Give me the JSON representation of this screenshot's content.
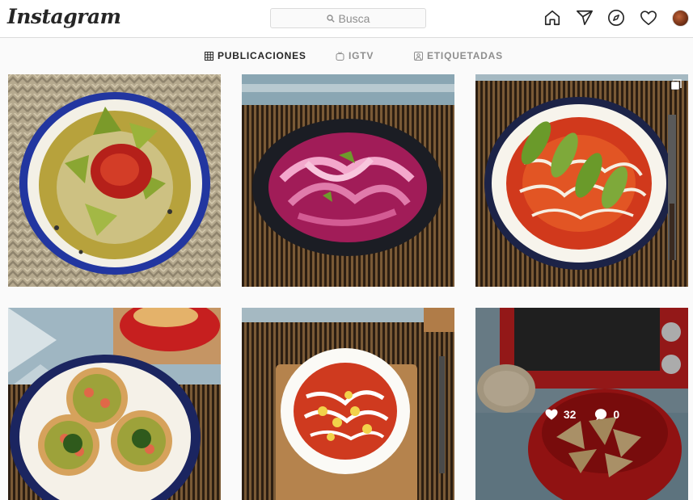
{
  "app": {
    "logo_text": "Instagram"
  },
  "search": {
    "placeholder": "Busca"
  },
  "nav": [
    {
      "name": "home-icon",
      "label": "Inicio"
    },
    {
      "name": "direct-icon",
      "label": "Direct"
    },
    {
      "name": "explore-icon",
      "label": "Explorar"
    },
    {
      "name": "heart-icon",
      "label": "Actividad"
    },
    {
      "name": "avatar",
      "label": "Perfil"
    }
  ],
  "tabs": [
    {
      "label": "PUBLICACIONES",
      "active": true,
      "icon": "grid-icon"
    },
    {
      "label": "IGTV",
      "active": false,
      "icon": "igtv-icon"
    },
    {
      "label": "ETIQUETADAS",
      "active": false,
      "icon": "tagged-icon"
    }
  ],
  "posts": [
    {
      "description": "pozole verde",
      "multi": false
    },
    {
      "description": "cebolla morada encurtida",
      "multi": false
    },
    {
      "description": "enchiladas con aguacate",
      "multi": true
    },
    {
      "description": "tostadas de camarón",
      "multi": false
    },
    {
      "description": "enfrijoladas rojas",
      "multi": false
    },
    {
      "description": "totopos en tazón rojo",
      "multi": false,
      "likes": "32",
      "comments": "0"
    }
  ],
  "colors": {
    "border": "#dbdbdb",
    "muted": "#8e8e8e",
    "text": "#262626",
    "background": "#fafafa"
  }
}
